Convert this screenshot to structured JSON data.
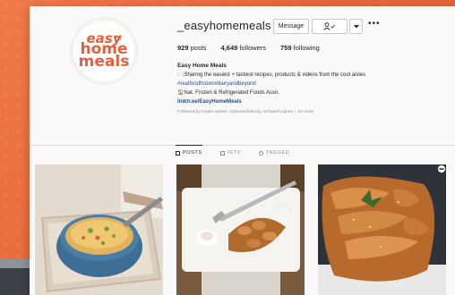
{
  "profile": {
    "logo_lines": [
      "easy",
      "home",
      "meals"
    ],
    "username": "_easyhomemeals",
    "buttons": {
      "message": "Message",
      "follow_icon": "person-check-icon",
      "dropdown_icon": "chevron-down-icon"
    },
    "more_label": "•••",
    "stats": {
      "posts_count": "929",
      "posts_label": "posts",
      "followers_count": "4,649",
      "followers_label": "followers",
      "following_count": "759",
      "following_label": "following"
    },
    "bio": {
      "name": "Easy Home Meals",
      "line1": "🍽️Sharing the easiest + tastiest recipes, products & videos from the cool aisles",
      "line2": "#realfoodfrozen#dairyandbeyond",
      "line3": "Nat. Frozen & Refrigerated Foods Assn.",
      "link": "linktr.ee/EasyHomeMeals",
      "followed_by": "Followed by foodie.stories, mybeautifulbody, michael.hughes + 10 more"
    }
  },
  "tabs": [
    {
      "label": "POSTS",
      "icon": "grid-icon"
    },
    {
      "label": "IGTV",
      "icon": "tv-icon"
    },
    {
      "label": "TAGGED",
      "icon": "tag-icon"
    }
  ],
  "posts": [
    {
      "description": "risotto-bowl"
    },
    {
      "description": "plated-dish"
    },
    {
      "description": "braided-bread"
    }
  ],
  "colors": {
    "brand": "#e8603a",
    "link": "#1d4e89",
    "text": "#262626",
    "muted": "#8e8e8e"
  }
}
